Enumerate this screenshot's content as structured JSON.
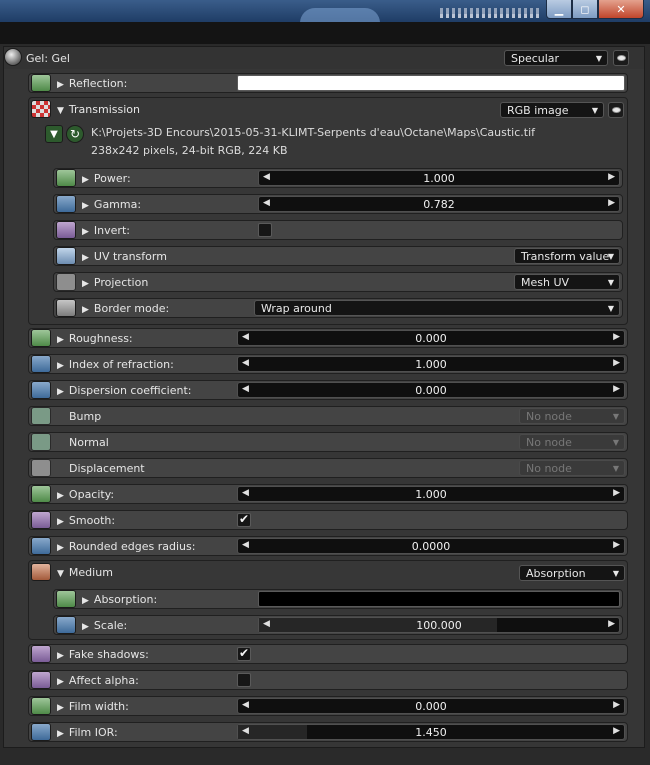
{
  "window": {
    "minimize": "▁",
    "maximize": "◻",
    "close": "✕"
  },
  "header": {
    "title": "Gel: Gel",
    "material_type": "Specular"
  },
  "rows": {
    "reflection": {
      "label": "Reflection:",
      "color": "#ffffff"
    },
    "transmission": {
      "label": "Transmission",
      "type": "RGB image",
      "path": "K:\\Projets-3D Encours\\2015-05-31-KLIMT-Serpents d'eau\\Octane\\Maps\\Caustic.tif",
      "info": "238x242 pixels, 24-bit RGB, 224 KB",
      "power": {
        "label": "Power:",
        "value": "1.000",
        "fraction": 0.0
      },
      "gamma": {
        "label": "Gamma:",
        "value": "0.782",
        "fraction": 0.0
      },
      "invert": {
        "label": "Invert:",
        "checked": false
      },
      "uv_transform": {
        "label": "UV transform",
        "value": "Transform value"
      },
      "projection": {
        "label": "Projection",
        "value": "Mesh UV"
      },
      "border_mode": {
        "label": "Border mode:",
        "value": "Wrap around"
      }
    },
    "roughness": {
      "label": "Roughness:",
      "value": "0.000",
      "fraction": 0.0
    },
    "ior": {
      "label": "Index of refraction:",
      "value": "1.000",
      "fraction": 0.0
    },
    "dispersion": {
      "label": "Dispersion coefficient:",
      "value": "0.000",
      "fraction": 0.0
    },
    "bump": {
      "label": "Bump",
      "value": "No node"
    },
    "normal": {
      "label": "Normal",
      "value": "No node"
    },
    "displacement": {
      "label": "Displacement",
      "value": "No node"
    },
    "opacity": {
      "label": "Opacity:",
      "value": "1.000",
      "fraction": 0.0
    },
    "smooth": {
      "label": "Smooth:",
      "checked": true
    },
    "rounded": {
      "label": "Rounded edges radius:",
      "value": "0.0000",
      "fraction": 0.0
    },
    "medium": {
      "label": "Medium",
      "type": "Absorption",
      "absorption": {
        "label": "Absorption:",
        "color": "#000000"
      },
      "scale": {
        "label": "Scale:",
        "value": "100.000",
        "fraction": 0.66
      }
    },
    "fake_shadows": {
      "label": "Fake shadows:",
      "checked": true
    },
    "affect_alpha": {
      "label": "Affect alpha:",
      "checked": false
    },
    "film_width": {
      "label": "Film width:",
      "value": "0.000",
      "fraction": 0.0
    },
    "film_ior": {
      "label": "Film IOR:",
      "value": "1.450",
      "fraction": 0.18
    }
  },
  "colors": {
    "panel": "#363636",
    "row": "#444444",
    "slider": "#0f0f0f",
    "float_icon": "#5b82ad",
    "bool_icon": "#9a7cb3"
  }
}
